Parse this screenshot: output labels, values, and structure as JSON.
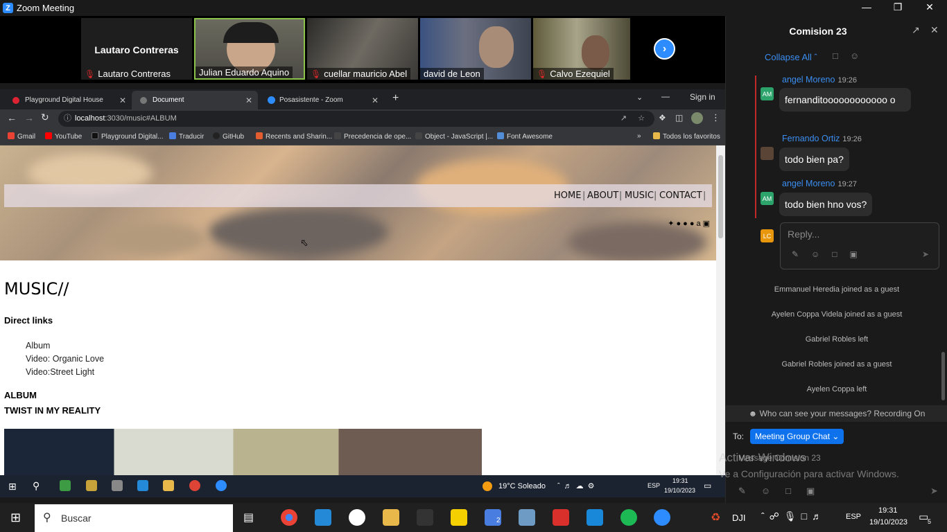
{
  "zoom": {
    "window_title": "Zoom Meeting",
    "active_speaker": "Lautaro Contreras",
    "participants": [
      {
        "name": "Lautaro Contreras",
        "muted": true
      },
      {
        "name": "Julian Eduardo Aquino",
        "muted": false
      },
      {
        "name": "cuellar mauricio Abel",
        "muted": true
      },
      {
        "name": "david de Leon",
        "muted": false
      },
      {
        "name": "Calvo Ezequiel",
        "muted": true
      }
    ]
  },
  "browser": {
    "tabs": [
      {
        "title": "Playground Digital House",
        "overlay": "Recording"
      },
      {
        "title": "Document"
      },
      {
        "title": "Posasistente - Zoom"
      }
    ],
    "sign_in": "Sign in",
    "url_host": "localhost",
    "url_path": ":3030/music#ALBUM",
    "bookmarks": [
      "Gmail",
      "YouTube",
      "Playground Digital...",
      "Traducir",
      "GitHub",
      "Recents and Sharin...",
      "Precedencia de ope...",
      "Object - JavaScript |...",
      "Font Awesome"
    ],
    "bookmarks_folder": "Todos los favoritos"
  },
  "page": {
    "nav": [
      "HOME",
      "ABOUT",
      "MUSIC",
      "CONTACT"
    ],
    "heading": "MUSIC//",
    "direct_links_title": "Direct links",
    "links": [
      "Album",
      "Video: Organic Love",
      "Video:Street Light"
    ],
    "album_label": "ALBUM",
    "album_title": "TWIST IN MY REALITY"
  },
  "inner_taskbar": {
    "weather": "19°C  Soleado",
    "lang": "ESP",
    "time": "19:31",
    "date": "19/10/2023",
    "notif": "3"
  },
  "chat": {
    "title": "Comision 23",
    "collapse_label": "Collapse All",
    "messages": [
      {
        "author": "angel Moreno",
        "time": "19:26",
        "initials": "AM",
        "text": "fernanditoooooooooooo o"
      },
      {
        "author": "Fernando Ortiz",
        "time": "19:26",
        "initials": "",
        "text": "todo bien pa?"
      },
      {
        "author": "angel Moreno",
        "time": "19:27",
        "initials": "AM",
        "text": "todo bien hno vos?"
      }
    ],
    "reply_initials": "LC",
    "reply_placeholder": "Reply...",
    "system_messages": [
      "Emmanuel Heredia joined as a guest",
      "Ayelen Coppa Videla joined as a guest",
      "Gabriel Robles left",
      "Gabriel Robles joined as a guest",
      "Ayelen Coppa left"
    ],
    "visibility_note": "Who can see your messages? Recording On",
    "to_label": "To:",
    "recipient": "Meeting Group Chat",
    "input_placeholder": "Message Comision 23",
    "watermark_title": "Activar Windows",
    "watermark_text": "Ve a Configuración para activar Windows."
  },
  "taskbar": {
    "search_placeholder": "Buscar",
    "mail_badge": "2",
    "dji_label": "DJI",
    "lang": "ESP",
    "time": "19:31",
    "date": "19/10/2023",
    "notif": "5"
  },
  "colors": {
    "zoom_blue": "#2d8cff",
    "chat_link": "#3b8ef0",
    "recipient_btn": "#0e72ed"
  }
}
